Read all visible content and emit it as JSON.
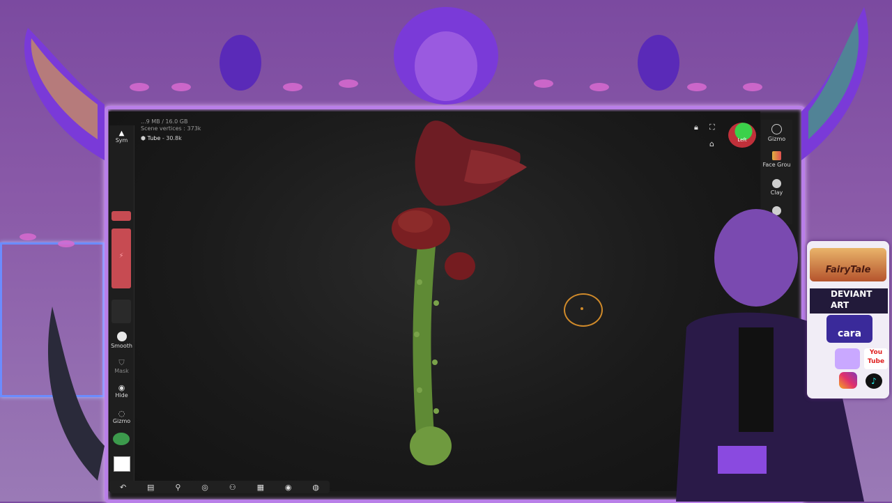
{
  "viewport": {
    "stats_line1": "...9 MB / 16.0 GB",
    "stats_line2": "Scene vertices : 373k",
    "mesh_name": "Tube",
    "mesh_count": "30.8k"
  },
  "left_toolbar": {
    "sym_label": "Sym",
    "smooth_label": "Smooth",
    "mask_label": "Mask",
    "hide_label": "Hide",
    "gizmo_label": "Gizmo",
    "slider_glyph": "⚡"
  },
  "right_toolbar": {
    "gizmo_label": "Gizmo",
    "facegroup_label": "Face Grou",
    "clay_label": "Clay"
  },
  "view_cube_label": "Left",
  "bottom_toolbar": [
    "↶",
    "▤",
    "⚲",
    "◎",
    "⚇",
    "▦",
    "◉",
    "◍"
  ],
  "side_panel": {
    "fairytale_text": "FairyTale",
    "deviantart_text": "DEVIANT ART",
    "cara_text": "cara",
    "youtube_text": "You Tube",
    "tiktok_glyph": "♪"
  },
  "colors": {
    "accent": "#b97fe8",
    "slider_red": "#c74b52",
    "brush_cursor": "#d08a2a"
  }
}
